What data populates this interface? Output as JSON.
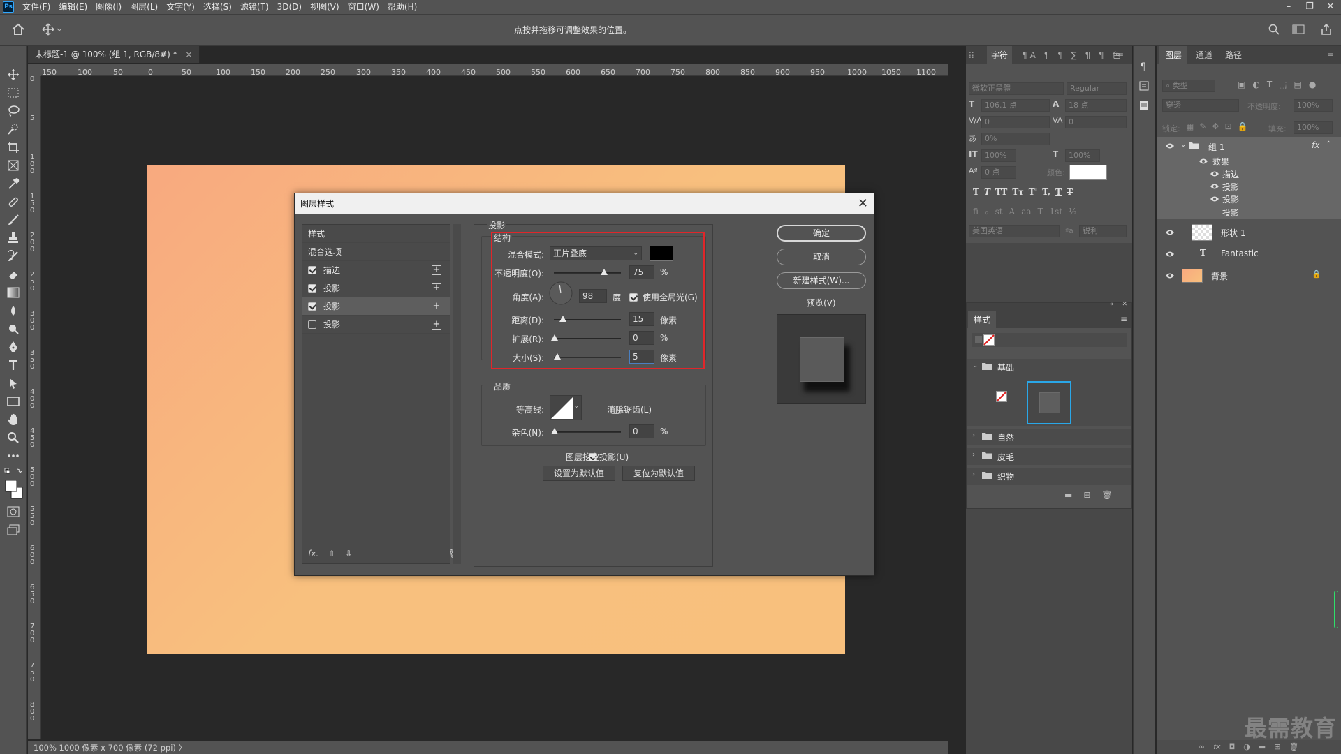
{
  "app": {
    "logo": "Ps"
  },
  "menu": [
    "文件(F)",
    "编辑(E)",
    "图像(I)",
    "图层(L)",
    "文字(Y)",
    "选择(S)",
    "滤镜(T)",
    "3D(D)",
    "视图(V)",
    "窗口(W)",
    "帮助(H)"
  ],
  "options_hint": "点按并拖移可调整效果的位置。",
  "document": {
    "tab_label": "未标题-1 @ 100% (组 1, RGB/8#) *",
    "status": "100%   1000 像素 x 700 像素 (72 ppi)  〉",
    "ruler_h": [
      "150",
      "100",
      "50",
      "0",
      "50",
      "100",
      "150",
      "200",
      "250",
      "300",
      "350",
      "400",
      "450",
      "500",
      "550",
      "600",
      "650",
      "700",
      "750",
      "800",
      "850",
      "900",
      "950",
      "1000",
      "1050",
      "1100"
    ],
    "ruler_v": [
      "0",
      "5",
      "1 0 0",
      "1 5 0",
      "2 0 0",
      "2 5 0",
      "3 0 0",
      "3 5 0",
      "4 0 0",
      "4 5 0",
      "5 0 0",
      "5 5 0",
      "6 0 0",
      "6 5 0",
      "7 0 0",
      "7 5 0",
      "8 0 0"
    ]
  },
  "dialog": {
    "title": "图层样式",
    "list": {
      "header": "样式",
      "blend": "混合选项",
      "items": [
        {
          "label": "描边",
          "checked": true
        },
        {
          "label": "投影",
          "checked": true
        },
        {
          "label": "投影",
          "checked": true
        },
        {
          "label": "投影",
          "checked": false
        }
      ]
    },
    "section_title": "投影",
    "structure": {
      "title": "结构",
      "blend_mode_label": "混合模式:",
      "blend_mode_value": "正片叠底",
      "opacity_label": "不透明度(O):",
      "opacity_value": "75",
      "opacity_unit": "%",
      "opacity_pct": 75,
      "angle_label": "角度(A):",
      "angle_value": "98",
      "angle_unit": "度",
      "global_light_label": "使用全局光(G)",
      "distance_label": "距离(D):",
      "distance_value": "15",
      "distance_unit": "像素",
      "spread_label": "扩展(R):",
      "spread_value": "0",
      "spread_unit": "%",
      "size_label": "大小(S):",
      "size_value": "5",
      "size_unit": "像素"
    },
    "quality": {
      "title": "品质",
      "contour_label": "等高线:",
      "antialias_label": "消除锯齿(L)",
      "noise_label": "杂色(N):",
      "noise_value": "0",
      "noise_unit": "%"
    },
    "knockout_label": "图层挖空投影(U)",
    "make_default": "设置为默认值",
    "reset_default": "复位为默认值",
    "ok": "确定",
    "cancel": "取消",
    "new_style": "新建样式(W)...",
    "preview_label": "预览(V)"
  },
  "character_panel": {
    "tabs": [
      "字符"
    ],
    "font_family": "微软正黑體",
    "font_style": "Regular",
    "size": "106.1 点",
    "leading": "18 点",
    "kerning": "0",
    "tracking": "0",
    "scale_pct": "0%",
    "vscale": "100%",
    "hscale": "100%",
    "baseline": "0 点",
    "color_label": "颜色:",
    "language": "美国英语",
    "aa": "锐利",
    "aa_icon": "ªa",
    "style_buttons": [
      "T",
      "T",
      "TT",
      "Tт",
      "T'",
      "T,",
      "T",
      "T"
    ],
    "ot_buttons": [
      "fi",
      "ℴ",
      "st",
      "A",
      "aa",
      "T",
      "1st",
      "½"
    ]
  },
  "styles_panel": {
    "title": "样式",
    "groups": [
      {
        "label": "基础",
        "open": true
      },
      {
        "label": "自然",
        "open": false
      },
      {
        "label": "皮毛",
        "open": false
      },
      {
        "label": "织物",
        "open": false
      }
    ]
  },
  "layers_panel": {
    "tabs": [
      "图层",
      "通道",
      "路径"
    ],
    "filter_placeholder": "类型",
    "blend": "穿透",
    "opacity_label": "不透明度:",
    "opacity": "100%",
    "lock_label": "锁定:",
    "fill_label": "填充:",
    "fill": "100%",
    "layers": [
      {
        "name": "组 1",
        "kind": "group"
      },
      {
        "name": "效果",
        "kind": "fx-header"
      },
      {
        "name": "描边",
        "kind": "fx"
      },
      {
        "name": "投影",
        "kind": "fx"
      },
      {
        "name": "投影",
        "kind": "fx"
      },
      {
        "name": "投影",
        "kind": "fx-hidden"
      },
      {
        "name": "形状 1",
        "kind": "shape"
      },
      {
        "name": "Fantastic",
        "kind": "text"
      },
      {
        "name": "背景",
        "kind": "background"
      }
    ]
  },
  "watermark": "最需教育",
  "colors": {
    "accent_red": "#e0262a",
    "canvas_a": "#f8a97f",
    "canvas_b": "#f8c07e"
  }
}
